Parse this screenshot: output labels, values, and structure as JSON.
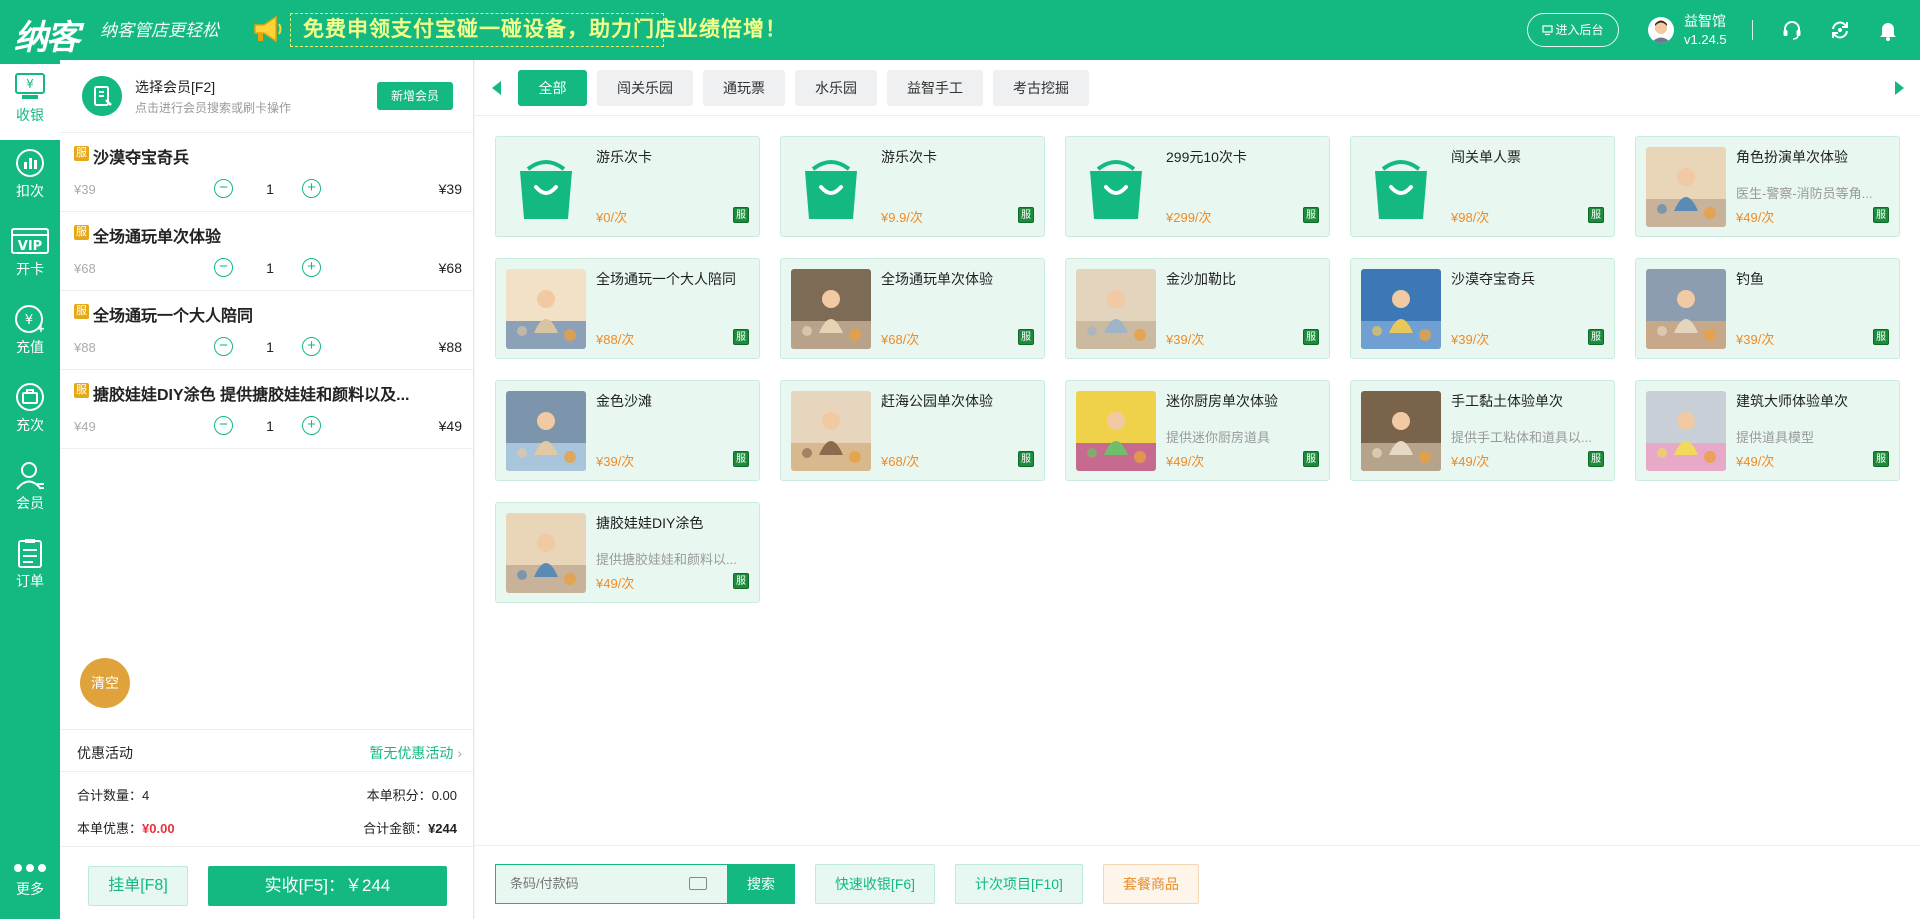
{
  "header": {
    "logo": "纳客",
    "slogan": "纳客管店更轻松",
    "promo": "免费申领支付宝碰一碰设备，助力门店业绩倍增！",
    "admin_button": "进入后台",
    "store_name": "益智馆",
    "version": "v1.24.5",
    "icons": [
      "headset-icon",
      "refresh-icon",
      "bell-icon"
    ]
  },
  "nav": {
    "items": [
      {
        "label": "收银",
        "icon": "cashier-icon",
        "active": true
      },
      {
        "label": "扣次",
        "icon": "chart-icon"
      },
      {
        "label": "开卡",
        "icon": "vip-card-icon"
      },
      {
        "label": "充值",
        "icon": "recharge-icon"
      },
      {
        "label": "充次",
        "icon": "recharge-times-icon"
      },
      {
        "label": "会员",
        "icon": "member-icon"
      },
      {
        "label": "订单",
        "icon": "order-icon"
      }
    ],
    "more": "更多"
  },
  "member": {
    "title": "选择会员[F2]",
    "hint": "点击进行会员搜索或刷卡操作",
    "add_button": "新增会员"
  },
  "cart": {
    "badge": "服",
    "items": [
      {
        "name": "沙漠夺宝奇兵",
        "price": "¥39",
        "qty": "1",
        "subtotal": "¥39"
      },
      {
        "name": "全场通玩单次体验",
        "price": "¥68",
        "qty": "1",
        "subtotal": "¥68"
      },
      {
        "name": "全场通玩一个大人陪同",
        "price": "¥88",
        "qty": "1",
        "subtotal": "¥88"
      },
      {
        "name": "搪胶娃娃DIY涂色 提供搪胶娃娃和颜料以及...",
        "price": "¥49",
        "qty": "1",
        "subtotal": "¥49"
      }
    ],
    "clear_button": "清空",
    "promo_label": "优惠活动",
    "promo_value": "暂无优惠活动",
    "total_qty_label": "合计数量：",
    "total_qty": "4",
    "points_label": "本单积分：",
    "points": "0.00",
    "discount_label": "本单优惠：",
    "discount": "¥0.00",
    "total_amount_label": "合计金额：",
    "total_amount": "¥244",
    "hold_button": "挂单[F8]",
    "pay_button": "实收[F5]：￥244"
  },
  "tabs": [
    {
      "label": "全部",
      "active": true
    },
    {
      "label": "闯关乐园"
    },
    {
      "label": "通玩票"
    },
    {
      "label": "水乐园"
    },
    {
      "label": "益智手工"
    },
    {
      "label": "考古挖掘"
    }
  ],
  "products": [
    {
      "name": "游乐次卡",
      "desc": "",
      "price": "¥0/次",
      "image": "shopping-bag-icon"
    },
    {
      "name": "游乐次卡",
      "desc": "",
      "price": "¥9.9/次",
      "image": "shopping-bag-icon"
    },
    {
      "name": "299元10次卡",
      "desc": "",
      "price": "¥299/次",
      "image": "shopping-bag-icon"
    },
    {
      "name": "闯关单人票",
      "desc": "",
      "price": "¥98/次",
      "image": "shopping-bag-icon"
    },
    {
      "name": "角色扮演单次体验",
      "desc": "医生-警察-消防员等角...",
      "price": "¥49/次",
      "image": "photo"
    },
    {
      "name": "全场通玩一个大人陪同",
      "desc": "",
      "price": "¥88/次",
      "image": "photo"
    },
    {
      "name": "全场通玩单次体验",
      "desc": "",
      "price": "¥68/次",
      "image": "photo"
    },
    {
      "name": "金沙加勒比",
      "desc": "",
      "price": "¥39/次",
      "image": "photo"
    },
    {
      "name": "沙漠夺宝奇兵",
      "desc": "",
      "price": "¥39/次",
      "image": "photo"
    },
    {
      "name": "钓鱼",
      "desc": "",
      "price": "¥39/次",
      "image": "photo"
    },
    {
      "name": "金色沙滩",
      "desc": "",
      "price": "¥39/次",
      "image": "photo"
    },
    {
      "name": "赶海公园单次体验",
      "desc": "",
      "price": "¥68/次",
      "image": "photo"
    },
    {
      "name": "迷你厨房单次体验",
      "desc": "提供迷你厨房道具",
      "price": "¥49/次",
      "image": "photo"
    },
    {
      "name": "手工黏土体验单次",
      "desc": "提供手工粘体和道具以...",
      "price": "¥49/次",
      "image": "photo"
    },
    {
      "name": "建筑大师体验单次",
      "desc": "提供道具模型",
      "price": "¥49/次",
      "image": "photo"
    },
    {
      "name": "搪胶娃娃DIY涂色",
      "desc": "提供搪胶娃娃和颜料以...",
      "price": "¥49/次",
      "image": "photo"
    }
  ],
  "bottom": {
    "scan_placeholder": "条码/付款码",
    "search_button": "搜索",
    "quick_button": "快速收银[F6]",
    "times_button": "计次项目[F10]",
    "package_button": "套餐商品"
  },
  "colors": {
    "brand": "#13b981",
    "price": "#f08a24",
    "discount": "#e8333d"
  }
}
